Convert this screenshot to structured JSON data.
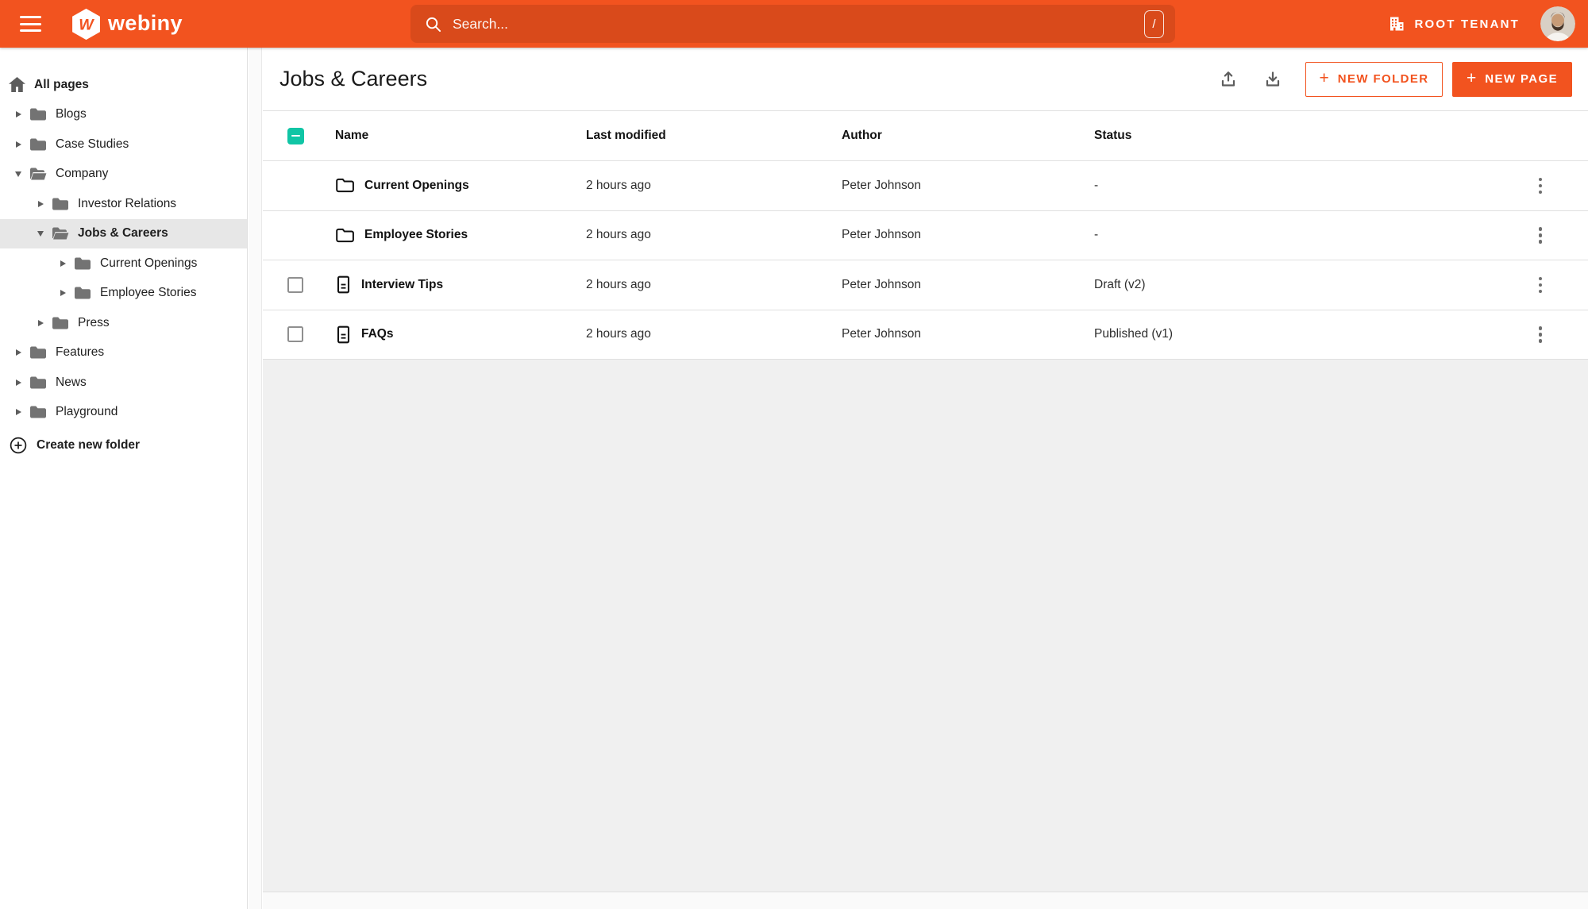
{
  "topbar": {
    "brand": "webiny",
    "search": {
      "placeholder": "Search...",
      "shortcut": "/"
    },
    "tenant_label": "ROOT TENANT"
  },
  "colors": {
    "brand_orange": "#f2531f",
    "teal": "#10c5a5"
  },
  "sidebar": {
    "root_label": "All pages",
    "items": [
      {
        "label": "Blogs",
        "level": 0,
        "expanded": false
      },
      {
        "label": "Case Studies",
        "level": 0,
        "expanded": false
      },
      {
        "label": "Company",
        "level": 0,
        "expanded": true
      },
      {
        "label": "Investor Relations",
        "level": 1,
        "expanded": false
      },
      {
        "label": "Jobs & Careers",
        "level": 1,
        "expanded": true,
        "selected": true
      },
      {
        "label": "Current Openings",
        "level": 2,
        "expanded": false
      },
      {
        "label": "Employee Stories",
        "level": 2,
        "expanded": false
      },
      {
        "label": "Press",
        "level": 1,
        "expanded": false
      },
      {
        "label": "Features",
        "level": 0,
        "expanded": false
      },
      {
        "label": "News",
        "level": 0,
        "expanded": false
      },
      {
        "label": "Playground",
        "level": 0,
        "expanded": false
      }
    ],
    "create_folder_label": "Create new folder"
  },
  "header": {
    "title": "Jobs & Careers",
    "new_folder_label": "NEW FOLDER",
    "new_page_label": "NEW PAGE",
    "plus": "+"
  },
  "table": {
    "columns": [
      "Name",
      "Last modified",
      "Author",
      "Status"
    ],
    "rows": [
      {
        "type": "folder",
        "name": "Current Openings",
        "modified": "2 hours ago",
        "author": "Peter Johnson",
        "status": "-"
      },
      {
        "type": "folder",
        "name": "Employee Stories",
        "modified": "2 hours ago",
        "author": "Peter Johnson",
        "status": "-"
      },
      {
        "type": "page",
        "name": "Interview Tips",
        "modified": "2 hours ago",
        "author": "Peter Johnson",
        "status": "Draft (v2)"
      },
      {
        "type": "page",
        "name": "FAQs",
        "modified": "2 hours ago",
        "author": "Peter Johnson",
        "status": "Published (v1)"
      }
    ]
  }
}
